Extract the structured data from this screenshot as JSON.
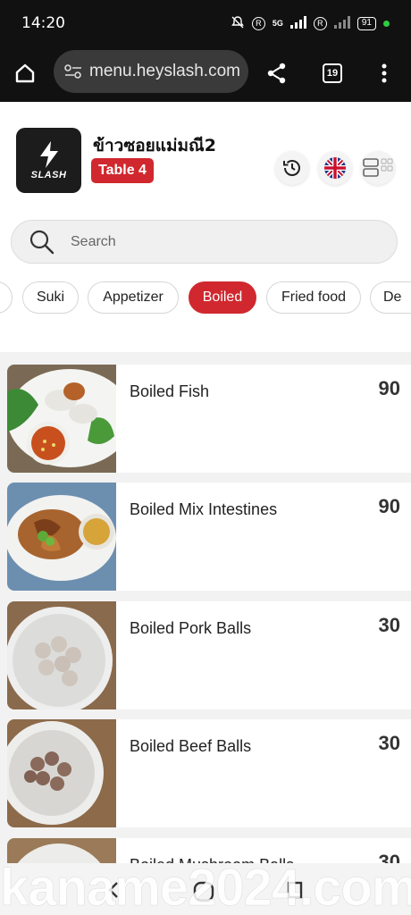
{
  "status_bar": {
    "time": "14:20",
    "network": "5G",
    "battery": "91"
  },
  "browser": {
    "url": "menu.heyslash.com",
    "tab_count": "19"
  },
  "shop": {
    "logo_text": "SLASH",
    "name": "ข้าวซอยแม่มณี2",
    "table": "Table 4"
  },
  "search": {
    "placeholder": "Search"
  },
  "categories": [
    "Suki",
    "Appetizer",
    "Boiled",
    "Fried food",
    "De"
  ],
  "active_category": "Boiled",
  "menu_items": [
    {
      "name": "Boiled Fish",
      "price": "90"
    },
    {
      "name": "Boiled Mix Intestines",
      "price": "90"
    },
    {
      "name": "Boiled Pork Balls",
      "price": "30"
    },
    {
      "name": "Boiled Beef Balls",
      "price": "30"
    },
    {
      "name": "Boiled Mushroom Balls",
      "price": "30"
    }
  ],
  "watermark": "kaname2024.com",
  "colors": {
    "accent": "#d0282e",
    "dark": "#111111"
  }
}
